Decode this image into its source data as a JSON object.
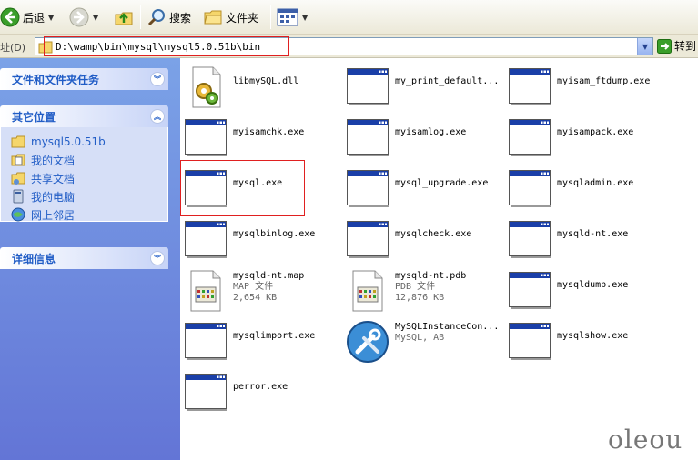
{
  "toolbar": {
    "back_label": "后退",
    "search_label": "搜索",
    "folders_label": "文件夹"
  },
  "address": {
    "label": "址(D)",
    "path": "D:\\wamp\\bin\\mysql\\mysql5.0.51b\\bin",
    "go_label": "转到"
  },
  "leftpane": {
    "tasks_title": "文件和文件夹任务",
    "places_title": "其它位置",
    "places": [
      {
        "label": "mysql5.0.51b",
        "icon": "folder-icon"
      },
      {
        "label": "我的文档",
        "icon": "my-documents-icon"
      },
      {
        "label": "共享文档",
        "icon": "shared-documents-icon"
      },
      {
        "label": "我的电脑",
        "icon": "my-computer-icon"
      },
      {
        "label": "网上邻居",
        "icon": "network-places-icon"
      }
    ],
    "details_title": "详细信息"
  },
  "files": [
    {
      "name": "libmySQL.dll",
      "type": "dll",
      "sub1": "",
      "sub2": ""
    },
    {
      "name": "my_print_default...",
      "type": "exe",
      "sub1": "",
      "sub2": ""
    },
    {
      "name": "myisam_ftdump.exe",
      "type": "exe",
      "sub1": "",
      "sub2": ""
    },
    {
      "name": "myisamchk.exe",
      "type": "exe",
      "sub1": "",
      "sub2": ""
    },
    {
      "name": "myisamlog.exe",
      "type": "exe",
      "sub1": "",
      "sub2": ""
    },
    {
      "name": "myisampack.exe",
      "type": "exe",
      "sub1": "",
      "sub2": ""
    },
    {
      "name": "mysql.exe",
      "type": "exe",
      "sub1": "",
      "sub2": ""
    },
    {
      "name": "mysql_upgrade.exe",
      "type": "exe",
      "sub1": "",
      "sub2": ""
    },
    {
      "name": "mysqladmin.exe",
      "type": "exe",
      "sub1": "",
      "sub2": ""
    },
    {
      "name": "mysqlbinlog.exe",
      "type": "exe",
      "sub1": "",
      "sub2": ""
    },
    {
      "name": "mysqlcheck.exe",
      "type": "exe",
      "sub1": "",
      "sub2": ""
    },
    {
      "name": "mysqld-nt.exe",
      "type": "exe",
      "sub1": "",
      "sub2": ""
    },
    {
      "name": "mysqld-nt.map",
      "type": "doc",
      "sub1": "MAP 文件",
      "sub2": "2,654 KB"
    },
    {
      "name": "mysqld-nt.pdb",
      "type": "doc",
      "sub1": "PDB 文件",
      "sub2": "12,876 KB"
    },
    {
      "name": "mysqldump.exe",
      "type": "exe",
      "sub1": "",
      "sub2": ""
    },
    {
      "name": "mysqlimport.exe",
      "type": "exe",
      "sub1": "",
      "sub2": ""
    },
    {
      "name": "MySQLInstanceCon...",
      "type": "tools",
      "sub1": "MySQL, AB",
      "sub2": ""
    },
    {
      "name": "mysqlshow.exe",
      "type": "exe",
      "sub1": "",
      "sub2": ""
    },
    {
      "name": "perror.exe",
      "type": "exe",
      "sub1": "",
      "sub2": ""
    }
  ],
  "watermark": "oleou"
}
